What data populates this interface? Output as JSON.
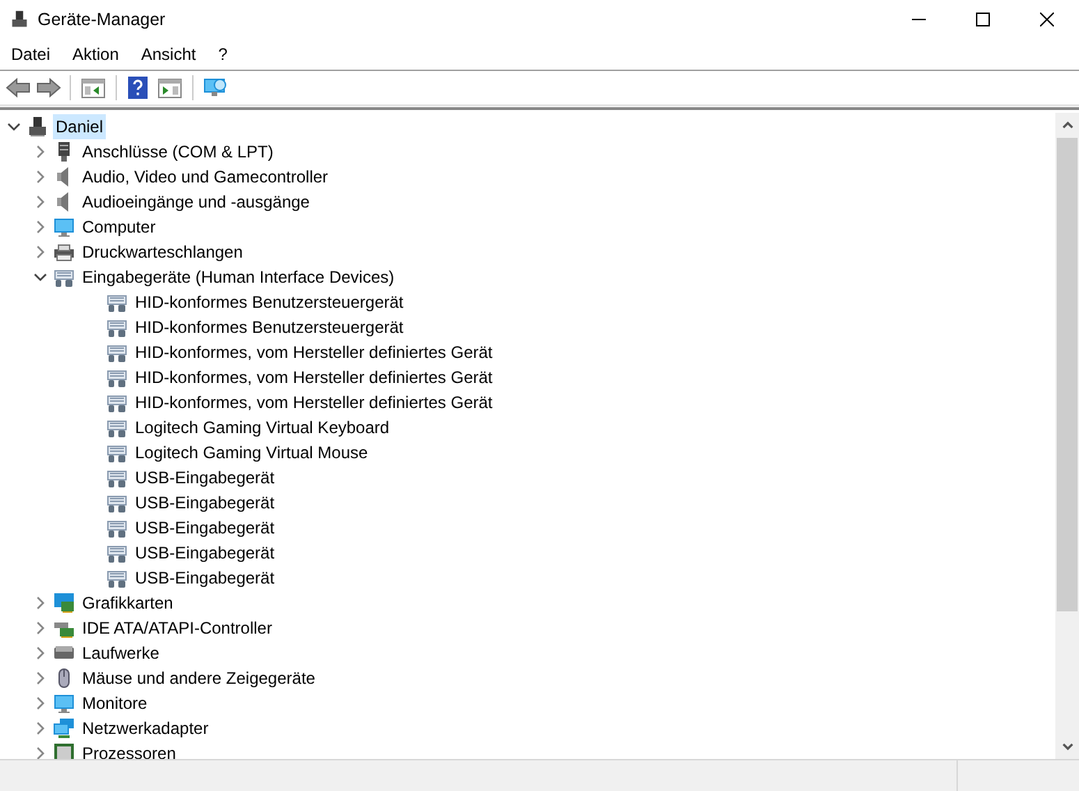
{
  "window": {
    "title": "Geräte-Manager"
  },
  "menu": [
    {
      "label": "Datei"
    },
    {
      "label": "Aktion"
    },
    {
      "label": "Ansicht"
    },
    {
      "label": "?"
    }
  ],
  "toolbar": [
    {
      "kind": "back",
      "disabled": false
    },
    {
      "kind": "forward",
      "disabled": false
    },
    {
      "kind": "separator"
    },
    {
      "kind": "tree-view",
      "disabled": false
    },
    {
      "kind": "separator"
    },
    {
      "kind": "help",
      "disabled": false
    },
    {
      "kind": "panel",
      "disabled": false
    },
    {
      "kind": "separator"
    },
    {
      "kind": "scan",
      "disabled": false
    }
  ],
  "tree": {
    "label": "Daniel",
    "kind": "computer-root",
    "expanded": true,
    "selected": true,
    "children": [
      {
        "label": "Anschlüsse (COM & LPT)",
        "kind": "port",
        "expanded": false,
        "selected": false
      },
      {
        "label": "Audio, Video und Gamecontroller",
        "kind": "audio",
        "expanded": false,
        "selected": false
      },
      {
        "label": "Audioeingänge und -ausgänge",
        "kind": "audio",
        "expanded": false,
        "selected": false
      },
      {
        "label": "Computer",
        "kind": "monitor",
        "expanded": false,
        "selected": false
      },
      {
        "label": "Druckwarteschlangen",
        "kind": "printer",
        "expanded": false,
        "selected": false
      },
      {
        "label": "Eingabegeräte (Human Interface Devices)",
        "kind": "hid",
        "expanded": true,
        "selected": false,
        "children": [
          {
            "label": "HID-konformes Benutzersteuergerät",
            "kind": "hid",
            "selected": false
          },
          {
            "label": "HID-konformes Benutzersteuergerät",
            "kind": "hid",
            "selected": false
          },
          {
            "label": "HID-konformes, vom Hersteller definiertes Gerät",
            "kind": "hid",
            "selected": false
          },
          {
            "label": "HID-konformes, vom Hersteller definiertes Gerät",
            "kind": "hid",
            "selected": false
          },
          {
            "label": "HID-konformes, vom Hersteller definiertes Gerät",
            "kind": "hid",
            "selected": false
          },
          {
            "label": "Logitech Gaming Virtual Keyboard",
            "kind": "hid",
            "selected": false
          },
          {
            "label": "Logitech Gaming Virtual Mouse",
            "kind": "hid",
            "selected": false
          },
          {
            "label": "USB-Eingabegerät",
            "kind": "hid",
            "selected": false
          },
          {
            "label": "USB-Eingabegerät",
            "kind": "hid",
            "selected": false
          },
          {
            "label": "USB-Eingabegerät",
            "kind": "hid",
            "selected": false
          },
          {
            "label": "USB-Eingabegerät",
            "kind": "hid",
            "selected": false
          },
          {
            "label": "USB-Eingabegerät",
            "kind": "hid",
            "selected": false
          }
        ]
      },
      {
        "label": "Grafikkarten",
        "kind": "card",
        "expanded": false,
        "selected": false
      },
      {
        "label": "IDE ATA/ATAPI-Controller",
        "kind": "controller",
        "expanded": false,
        "selected": false
      },
      {
        "label": "Laufwerke",
        "kind": "drive",
        "expanded": false,
        "selected": false
      },
      {
        "label": "Mäuse und andere Zeigegeräte",
        "kind": "mouse",
        "expanded": false,
        "selected": false
      },
      {
        "label": "Monitore",
        "kind": "monitor",
        "expanded": false,
        "selected": false
      },
      {
        "label": "Netzwerkadapter",
        "kind": "network",
        "expanded": false,
        "selected": false
      },
      {
        "label": "Prozessoren",
        "kind": "cpu",
        "expanded": false,
        "selected": false
      }
    ]
  }
}
